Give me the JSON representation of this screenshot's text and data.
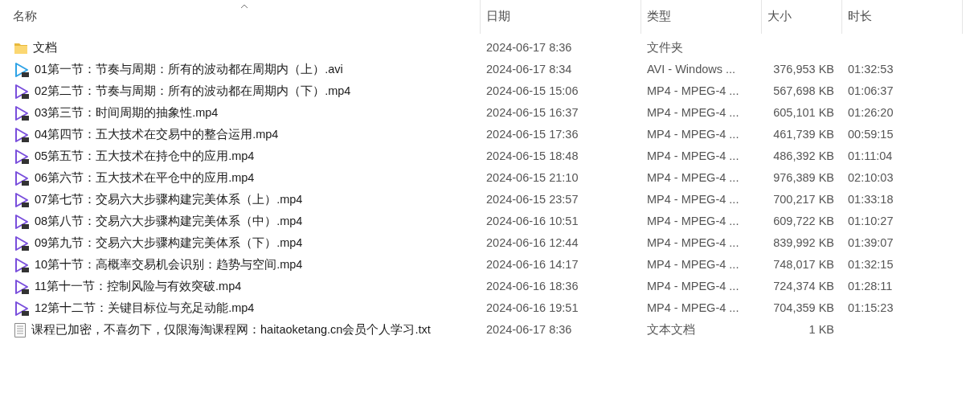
{
  "columns": [
    {
      "label": "名称",
      "sorted": true
    },
    {
      "label": "日期",
      "sorted": false
    },
    {
      "label": "类型",
      "sorted": false
    },
    {
      "label": "大小",
      "sorted": false
    },
    {
      "label": "时长",
      "sorted": false
    }
  ],
  "rows": [
    {
      "kind": "folder",
      "name": "文档",
      "date": "2024-06-17 8:36",
      "type": "文件夹",
      "size": "",
      "duration": ""
    },
    {
      "kind": "avi",
      "name": "01第一节：节奏与周期：所有的波动都在周期内（上）.avi",
      "date": "2024-06-17 8:34",
      "type": "AVI - Windows ...",
      "size": "376,953 KB",
      "duration": "01:32:53"
    },
    {
      "kind": "mp4",
      "name": "02第二节：节奏与周期：所有的波动都在周期内（下）.mp4",
      "date": "2024-06-15 15:06",
      "type": "MP4 - MPEG-4 ...",
      "size": "567,698 KB",
      "duration": "01:06:37"
    },
    {
      "kind": "mp4",
      "name": "03第三节：时间周期的抽象性.mp4",
      "date": "2024-06-15 16:37",
      "type": "MP4 - MPEG-4 ...",
      "size": "605,101 KB",
      "duration": "01:26:20"
    },
    {
      "kind": "mp4",
      "name": "04第四节：五大技术在交易中的整合运用.mp4",
      "date": "2024-06-15 17:36",
      "type": "MP4 - MPEG-4 ...",
      "size": "461,739 KB",
      "duration": "00:59:15"
    },
    {
      "kind": "mp4",
      "name": "05第五节：五大技术在持仓中的应用.mp4",
      "date": "2024-06-15 18:48",
      "type": "MP4 - MPEG-4 ...",
      "size": "486,392 KB",
      "duration": "01:11:04"
    },
    {
      "kind": "mp4",
      "name": "06第六节：五大技术在平仓中的应用.mp4",
      "date": "2024-06-15 21:10",
      "type": "MP4 - MPEG-4 ...",
      "size": "976,389 KB",
      "duration": "02:10:03"
    },
    {
      "kind": "mp4",
      "name": "07第七节：交易六大步骤构建完美体系（上）.mp4",
      "date": "2024-06-15 23:57",
      "type": "MP4 - MPEG-4 ...",
      "size": "700,217 KB",
      "duration": "01:33:18"
    },
    {
      "kind": "mp4",
      "name": "08第八节：交易六大步骤构建完美体系（中）.mp4",
      "date": "2024-06-16 10:51",
      "type": "MP4 - MPEG-4 ...",
      "size": "609,722 KB",
      "duration": "01:10:27"
    },
    {
      "kind": "mp4",
      "name": "09第九节：交易六大步骤构建完美体系（下）.mp4",
      "date": "2024-06-16 12:44",
      "type": "MP4 - MPEG-4 ...",
      "size": "839,992 KB",
      "duration": "01:39:07"
    },
    {
      "kind": "mp4",
      "name": "10第十节：高概率交易机会识别：趋势与空间.mp4",
      "date": "2024-06-16 14:17",
      "type": "MP4 - MPEG-4 ...",
      "size": "748,017 KB",
      "duration": "01:32:15"
    },
    {
      "kind": "mp4",
      "name": "11第十一节：控制风险与有效突破.mp4",
      "date": "2024-06-16 18:36",
      "type": "MP4 - MPEG-4 ...",
      "size": "724,374 KB",
      "duration": "01:28:11"
    },
    {
      "kind": "mp4",
      "name": "12第十二节：关键目标位与充足动能.mp4",
      "date": "2024-06-16 19:51",
      "type": "MP4 - MPEG-4 ...",
      "size": "704,359 KB",
      "duration": "01:15:23"
    },
    {
      "kind": "text",
      "name": "课程已加密，不喜勿下，仅限海淘课程网：haitaoketang.cn会员个人学习.txt",
      "date": "2024-06-17 8:36",
      "type": "文本文档",
      "size": "1 KB",
      "duration": ""
    }
  ]
}
